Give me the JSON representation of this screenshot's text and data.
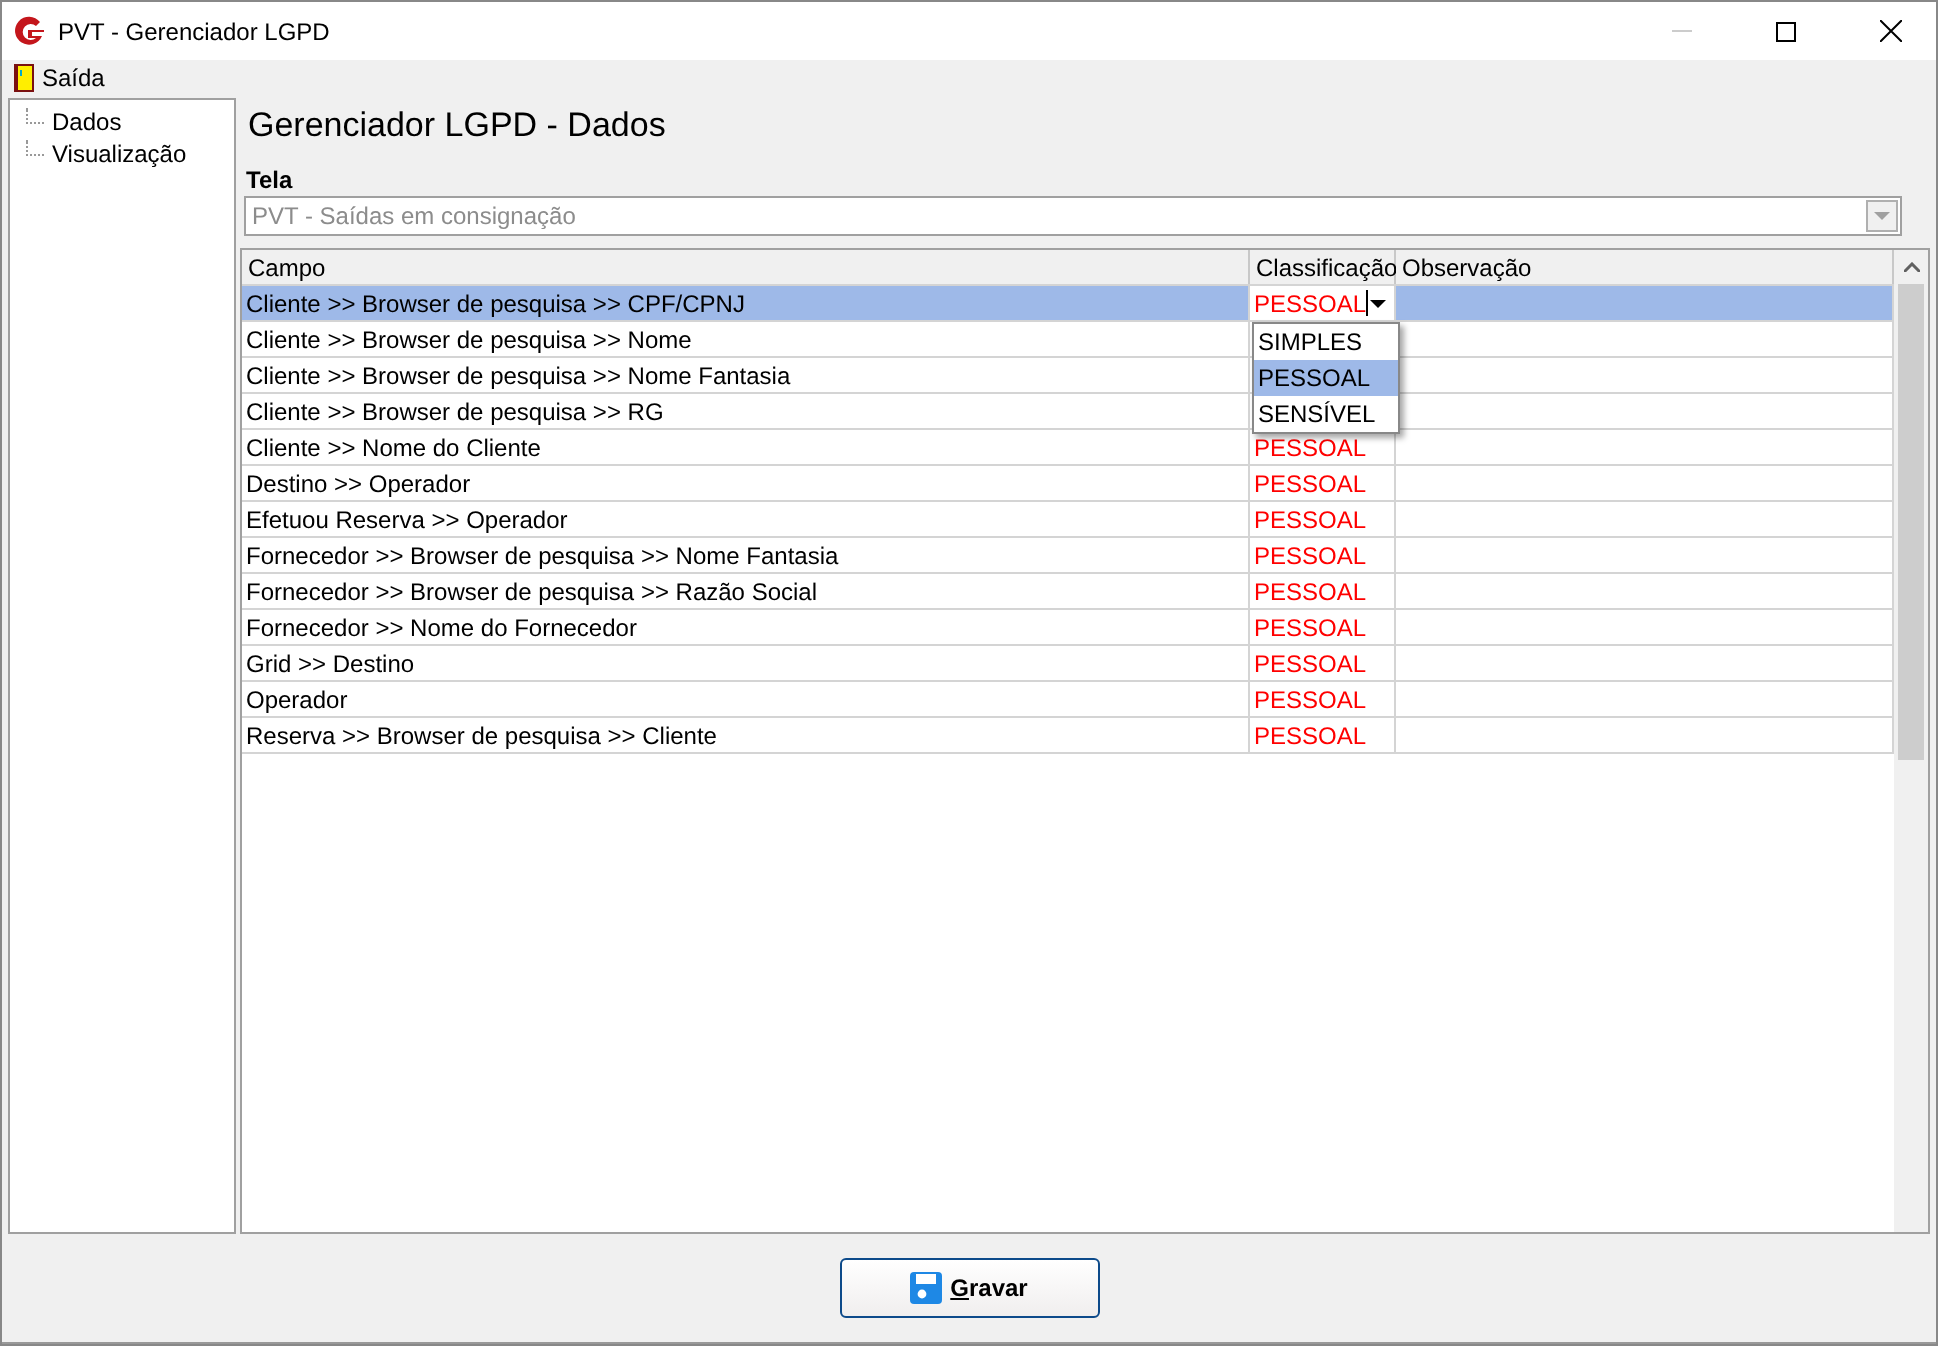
{
  "window": {
    "title": "PVT - Gerenciador LGPD"
  },
  "menu": [
    {
      "label": "Saída"
    }
  ],
  "tree": {
    "items": [
      {
        "label": "Dados",
        "selected": false
      },
      {
        "label": "Visualização",
        "selected": false
      }
    ]
  },
  "heading": "Gerenciador LGPD - Dados",
  "screen_field": {
    "label": "Tela",
    "value": "PVT - Saídas em consignação",
    "disabled": true
  },
  "table": {
    "columns": [
      "Campo",
      "Classificação",
      "Observação"
    ],
    "rows": [
      {
        "campo": "Cliente >> Browser de pesquisa >> CPF/CPNJ",
        "classificacao": "PESSOAL",
        "selected": true,
        "editing": true
      },
      {
        "campo": "Cliente >> Browser de pesquisa >> Nome",
        "selected": false
      },
      {
        "campo": "Cliente >> Browser de pesquisa >> Nome Fantasia",
        "selected": false
      },
      {
        "campo": "Cliente >> Browser de pesquisa >> RG",
        "selected": false
      },
      {
        "campo": "Cliente >> Nome do Cliente",
        "classificacao": "PESSOAL",
        "selected": false
      },
      {
        "campo": "Destino >> Operador",
        "classificacao": "PESSOAL",
        "selected": false
      },
      {
        "campo": "Efetuou Reserva >> Operador",
        "classificacao": "PESSOAL",
        "selected": false
      },
      {
        "campo": "Fornecedor >> Browser de pesquisa >> Nome Fantasia",
        "classificacao": "PESSOAL",
        "selected": false
      },
      {
        "campo": "Fornecedor >> Browser de pesquisa >> Razão Social",
        "classificacao": "PESSOAL",
        "selected": false
      },
      {
        "campo": "Fornecedor >> Nome do Fornecedor",
        "classificacao": "PESSOAL",
        "selected": false
      },
      {
        "campo": "Grid >> Destino",
        "classificacao": "PESSOAL",
        "selected": false
      },
      {
        "campo": "Operador",
        "classificacao": "PESSOAL",
        "selected": false
      },
      {
        "campo": "Reserva >> Browser de pesquisa >> Cliente",
        "classificacao": "PESSOAL",
        "selected": false
      }
    ],
    "dropdown_options": [
      {
        "label": "SIMPLES",
        "selected": false
      },
      {
        "label": "PESSOAL",
        "selected": true
      },
      {
        "label": "SENSÍVEL",
        "selected": false
      }
    ]
  },
  "save_button": {
    "access_key": "G",
    "label_rest": "ravar"
  }
}
